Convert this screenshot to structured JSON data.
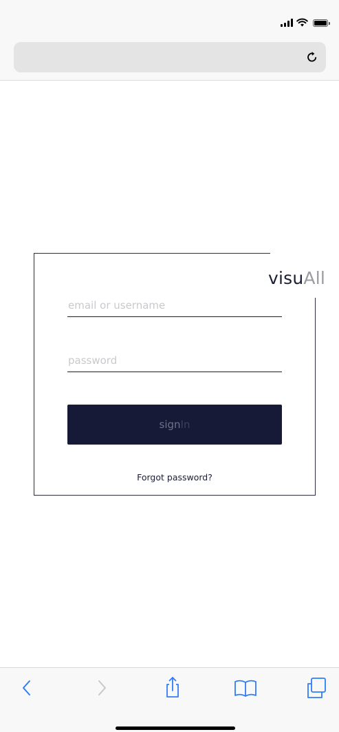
{
  "browser": {
    "status_icons": [
      "signal-icon",
      "wifi-icon",
      "battery-icon"
    ],
    "url": "",
    "reload_icon": "reload-icon"
  },
  "login": {
    "logo": {
      "part1": "visu",
      "part2": "All"
    },
    "email": {
      "placeholder": "email or username",
      "value": ""
    },
    "password": {
      "placeholder": "password",
      "value": ""
    },
    "signin": {
      "part1": "sign",
      "part2": "In"
    },
    "forgot": "Forgot password?"
  },
  "toolbar": {
    "icons": [
      "back-icon",
      "forward-icon",
      "share-icon",
      "bookmarks-icon",
      "tabs-icon"
    ]
  },
  "colors": {
    "brand_navy": "#161a36",
    "logo_grey": "#9a9aa2",
    "toolbar_blue": "#2f7cf6",
    "toolbar_disabled": "#c7c7cc",
    "chrome_bg": "#f8f8f8",
    "url_bar_bg": "#e4e4e5"
  }
}
